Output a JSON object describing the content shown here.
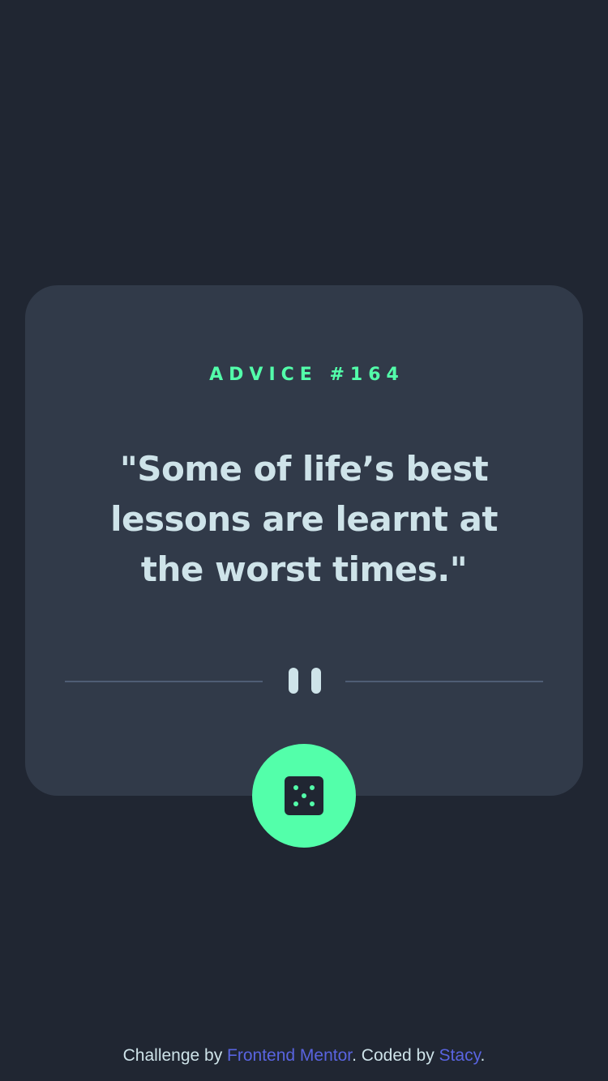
{
  "advice": {
    "label": "ADVICE #164",
    "quote": "\"Some of life’s best lessons are learnt at the worst times.\""
  },
  "divider": {
    "icon": "pause-icon"
  },
  "dice_button": {
    "icon": "dice-icon"
  },
  "footer": {
    "prefix": "Challenge by ",
    "link1": "Frontend Mentor",
    "middle": ". Coded by ",
    "link2": "Stacy",
    "suffix": "."
  },
  "colors": {
    "background": "#202632",
    "card": "#313a49",
    "accent": "#53ffaa",
    "text": "#cee3e9",
    "divider": "#4f5d74",
    "link": "#5964e0"
  }
}
